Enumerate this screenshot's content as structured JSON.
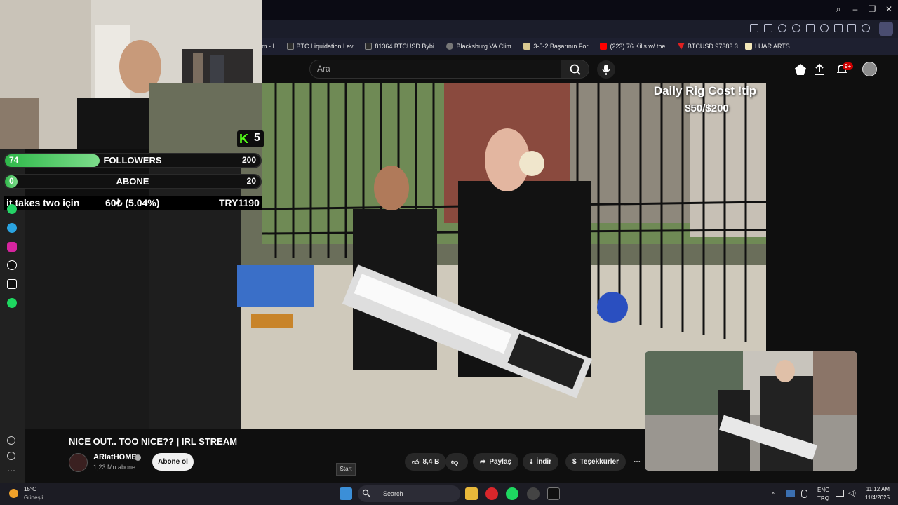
{
  "browser": {
    "bookmarks": [
      {
        "label": "m - I..."
      },
      {
        "label": "BTC Liquidation Lev..."
      },
      {
        "label": "81364 BTCUSD Bybi..."
      },
      {
        "label": "Blacksburg VA Clim..."
      },
      {
        "label": "3-5-2:Başarının For..."
      },
      {
        "label": "(223) 76 Kills w/ the..."
      },
      {
        "label": "BTCUSD 97383.3"
      },
      {
        "label": "LUAR ARTS"
      }
    ],
    "colors": {
      "bookmark_youtube": "#ff0000",
      "bookmark_tv": "#f7a600"
    }
  },
  "youtube": {
    "search_placeholder": "Ara",
    "notification_count": "9+"
  },
  "overlay": {
    "kick_count": "5",
    "followers": {
      "label": "FOLLOWERS",
      "current": "74",
      "goal": "200",
      "progress": 0.37
    },
    "abone": {
      "label": "ABONE",
      "current": "0",
      "goal": "20",
      "progress": 0.0
    },
    "tip": {
      "label": "it takes two için",
      "amount": "60₺ (5.04%)",
      "target": "TRY1190"
    },
    "rig_title": "Daily Rig Cost !tip",
    "rig_amount": "$50/$200"
  },
  "video": {
    "title": "NICE OUT.. TOO NICE?? | IRL STREAM",
    "channel": "ARlatHOME",
    "subscribers": "1,23 Mn abone",
    "subscribe_label": "Abone ol",
    "likes": "8,4 B",
    "share_label": "Paylaş",
    "download_label": "İndir",
    "thanks_label": "Teşekkürler"
  },
  "taskbar": {
    "start_tooltip": "Start",
    "temperature": "15°C",
    "weather": "Güneşli",
    "search_label": "Search",
    "lang1": "ENG",
    "lang2": "TRQ",
    "time": "11:12 AM",
    "date": "11/4/2025"
  }
}
